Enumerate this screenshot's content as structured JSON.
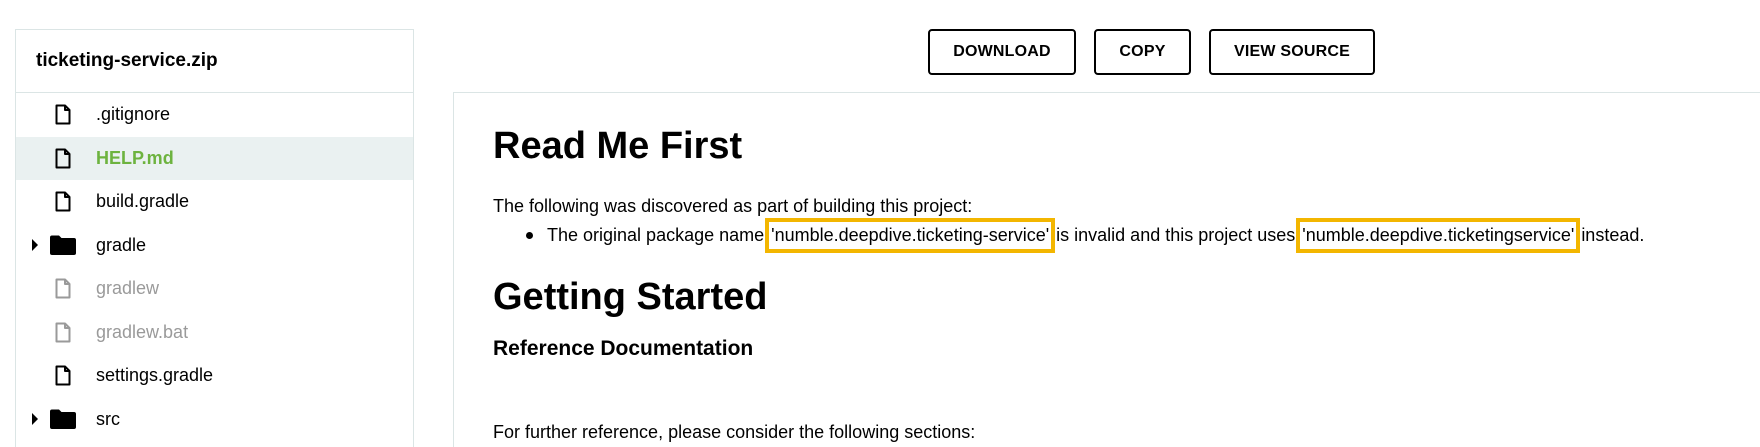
{
  "sidebar": {
    "title": "ticketing-service.zip",
    "items": [
      {
        "label": ".gitignore",
        "icon": "file-icon"
      },
      {
        "label": "HELP.md",
        "icon": "file-icon",
        "selected": true
      },
      {
        "label": "build.gradle",
        "icon": "file-icon"
      },
      {
        "label": "gradle",
        "icon": "folder-icon",
        "expandable": true
      },
      {
        "label": "gradlew",
        "icon": "file-icon",
        "muted": true
      },
      {
        "label": "gradlew.bat",
        "icon": "file-icon",
        "muted": true
      },
      {
        "label": "settings.gradle",
        "icon": "file-icon"
      },
      {
        "label": "src",
        "icon": "folder-icon",
        "expandable": true
      }
    ]
  },
  "toolbar": {
    "download_label": "DOWNLOAD",
    "copy_label": "COPY",
    "view_source_label": "VIEW SOURCE"
  },
  "content": {
    "heading1": "Read Me First",
    "intro": "The following was discovered as part of building this project:",
    "bullet": {
      "before": "The original package name ",
      "highlight1": "'numble.deepdive.ticketing-service'",
      "middle": " is invalid and this project uses ",
      "highlight2": "'numble.deepdive.ticketingservice'",
      "after": " instead."
    },
    "heading2": "Getting Started",
    "heading3": "Reference Documentation",
    "reference_text": "For further reference, please consider the following sections:"
  },
  "colors": {
    "selected_text": "#6db33f",
    "selected_bg": "#eaf1f1",
    "highlight_border": "#f3b600",
    "muted_text": "#9a9a9a"
  }
}
